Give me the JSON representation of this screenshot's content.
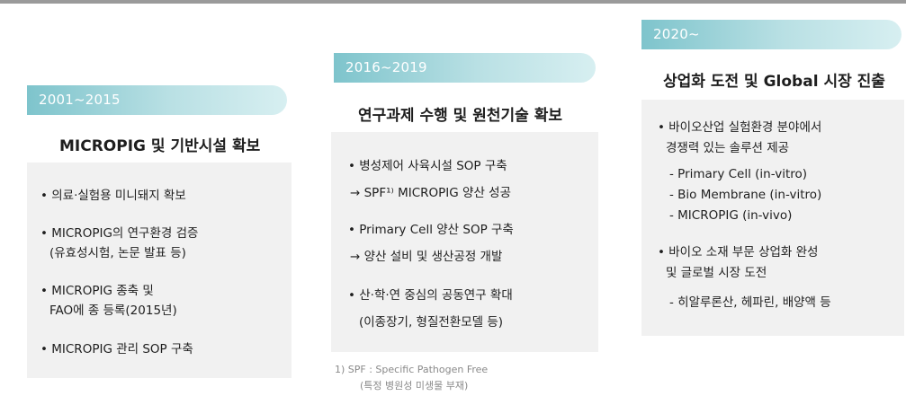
{
  "columns": [
    {
      "period": "2001~2015",
      "title": "MICROPIG 및 기반시설 확보",
      "lines": [
        "• 의료·실험용 미니돼지 확보",
        "• MICROPIG의 연구환경 검증",
        "(유효성시험, 논문 발표 등)",
        "• MICROPIG 종축 및",
        "FAO에 종 등록(2015년)",
        "• MICROPIG 관리 SOP 구축"
      ]
    },
    {
      "period": "2016~2019",
      "title": "연구과제 수행 및 원천기술 확보",
      "lines": [
        "• 병성제어 사육시설 SOP 구축",
        "→ SPF¹⁾ MICROPIG 양산 성공",
        "• Primary Cell 양산 SOP 구축",
        "→ 양산 설비 및 생산공정 개발",
        "• 산·학·연 중심의 공동연구 확대",
        "(이종장기, 형질전환모델 등)"
      ],
      "footnote": [
        "1) SPF : Specific Pathogen Free",
        "(특정 병원성 미생물 부재)"
      ]
    },
    {
      "period": "2020~",
      "title": "상업화 도전 및 Global 시장 진출",
      "lines": [
        "• 바이오산업 실험환경 분야에서",
        "경쟁력 있는 솔루션 제공",
        "- Primary Cell (in-vitro)",
        "- Bio Membrane (in-vitro)",
        "- MICROPIG (in-vivo)",
        "• 바이오 소재 부문 상업화 완성",
        "및 글로벌 시장 도전",
        "- 히알루론산, 헤파린, 배양액 등"
      ]
    }
  ],
  "colors": {
    "pill": "#7ec4cc",
    "panel": "#f1f1f1",
    "rule": "#9a9a9a"
  }
}
